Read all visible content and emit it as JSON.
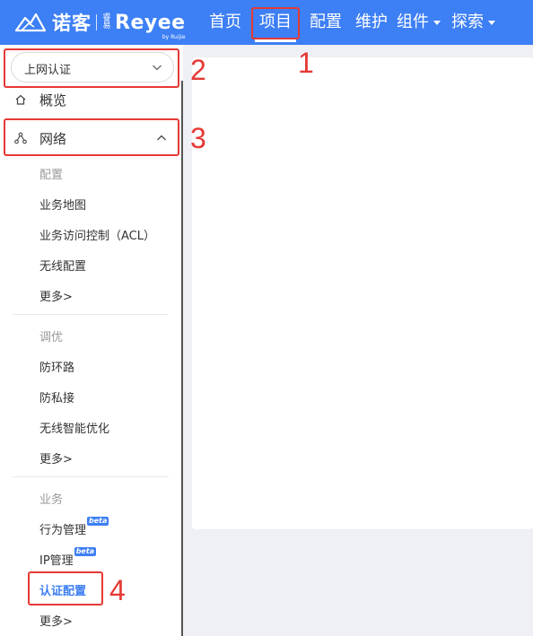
{
  "header": {
    "brand_cn": "诺客",
    "brand_sub": "睿易",
    "brand_en": "Reyee",
    "brand_by": "by Ruijie",
    "nav": [
      {
        "label": "首页",
        "active": false,
        "dropdown": false
      },
      {
        "label": "项目",
        "active": true,
        "dropdown": false
      },
      {
        "label": "配置",
        "active": false,
        "dropdown": false
      },
      {
        "label": "维护",
        "active": false,
        "dropdown": false
      },
      {
        "label": "组件",
        "active": false,
        "dropdown": true
      },
      {
        "label": "探索",
        "active": false,
        "dropdown": true
      }
    ]
  },
  "sidebar": {
    "select": {
      "value": "上网认证",
      "icon": "chevron-down-icon"
    },
    "menu": [
      {
        "label": "概览",
        "icon": "home-icon"
      },
      {
        "label": "网络",
        "icon": "network-topology-icon",
        "expanded": true
      }
    ],
    "groups": [
      {
        "title": "配置",
        "items": [
          "业务地图",
          "业务访问控制（ACL）",
          "无线配置",
          "更多>"
        ]
      },
      {
        "title": "调优",
        "items": [
          "防环路",
          "防私接",
          "无线智能优化",
          "更多>"
        ]
      },
      {
        "title": "业务",
        "items": [
          "行为管理",
          "IP管理",
          "认证配置",
          "更多>"
        ]
      }
    ],
    "beta_label": "beta",
    "active_item": "认证配置"
  },
  "annotations": [
    "1",
    "2",
    "3",
    "4"
  ],
  "colors": {
    "header_bg": "#3d7ff4",
    "accent": "#3d7ff4",
    "annotation": "#e53935",
    "content_bg": "#eef0f5"
  }
}
